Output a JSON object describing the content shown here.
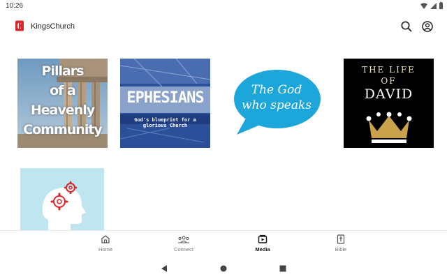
{
  "status_bar": {
    "time": "10:26",
    "icons": [
      "wifi-icon",
      "signal-icon",
      "battery-icon"
    ]
  },
  "app_bar": {
    "title": "KingsChurch",
    "logo": "kingschurch-logo",
    "actions": [
      "search-icon",
      "account-icon"
    ]
  },
  "media": {
    "items": [
      {
        "id": "pillars",
        "cover_lines": [
          "Pillars",
          "of a",
          "Heavenly",
          "Community"
        ]
      },
      {
        "id": "ephesians",
        "cover_title": "EPHESIANS",
        "cover_subtitle": "God's blueprint for a glorious Church"
      },
      {
        "id": "god_speaks",
        "cover_lines": [
          "The God",
          "who speaks"
        ]
      },
      {
        "id": "david",
        "cover_lines": [
          "THE LIFE",
          "OF"
        ],
        "cover_name": "DAVID"
      },
      {
        "id": "mind",
        "cover_image": "head-with-gears-illustration"
      }
    ]
  },
  "bottom_nav": {
    "items": [
      {
        "label": "Home",
        "icon": "home-icon",
        "active": false
      },
      {
        "label": "Connect",
        "icon": "people-icon",
        "active": false
      },
      {
        "label": "Media",
        "icon": "media-icon",
        "active": true
      },
      {
        "label": "Bible",
        "icon": "bible-icon",
        "active": false
      }
    ]
  },
  "system_nav": [
    "back-triangle-icon",
    "home-circle-icon",
    "recents-square-icon"
  ],
  "colors": {
    "brand_red": "#d8262c",
    "speech_bubble_blue": "#1ca6d9",
    "ephesians_blue": "#2c4f9a",
    "mind_bg": "#bfe5f0"
  }
}
